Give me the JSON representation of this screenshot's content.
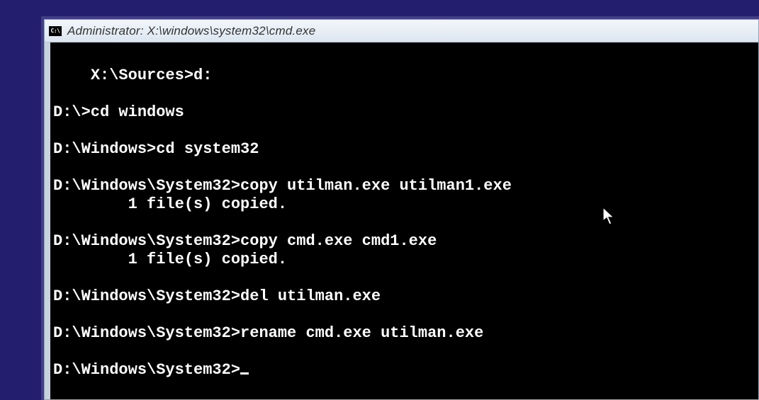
{
  "titlebar": {
    "icon_label": "C:\\",
    "title": "Administrator: X:\\windows\\system32\\cmd.exe"
  },
  "console": {
    "lines": [
      "X:\\Sources>d:",
      "",
      "D:\\>cd windows",
      "",
      "D:\\Windows>cd system32",
      "",
      "D:\\Windows\\System32>copy utilman.exe utilman1.exe",
      "        1 file(s) copied.",
      "",
      "D:\\Windows\\System32>copy cmd.exe cmd1.exe",
      "        1 file(s) copied.",
      "",
      "D:\\Windows\\System32>del utilman.exe",
      "",
      "D:\\Windows\\System32>rename cmd.exe utilman.exe",
      "",
      "D:\\Windows\\System32>"
    ]
  }
}
